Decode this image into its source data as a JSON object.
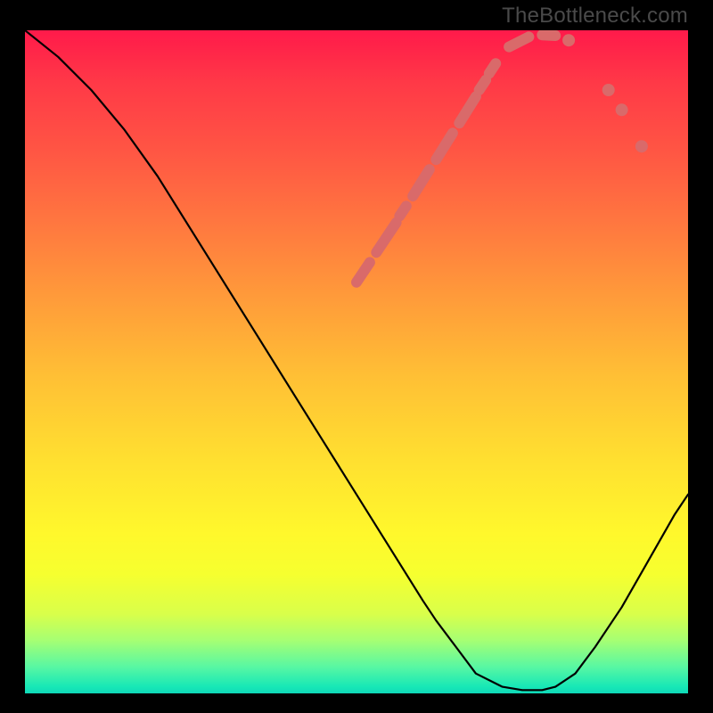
{
  "watermark": "TheBottleneck.com",
  "chart_data": {
    "type": "line",
    "title": "",
    "xlabel": "",
    "ylabel": "",
    "xlim": [
      0,
      100
    ],
    "ylim": [
      0,
      100
    ],
    "grid": false,
    "legend": false,
    "background": {
      "type": "vertical_gradient",
      "stops": [
        {
          "pos": 0,
          "color": "#ff1a4a"
        },
        {
          "pos": 0.18,
          "color": "#ff5544"
        },
        {
          "pos": 0.4,
          "color": "#ff9a3a"
        },
        {
          "pos": 0.65,
          "color": "#ffe030"
        },
        {
          "pos": 0.82,
          "color": "#f6ff2f"
        },
        {
          "pos": 0.92,
          "color": "#a6ff73"
        },
        {
          "pos": 1.0,
          "color": "#0fd8b8"
        }
      ]
    },
    "series": [
      {
        "name": "bottleneck-curve",
        "x": [
          0,
          5,
          10,
          15,
          20,
          25,
          30,
          35,
          40,
          45,
          50,
          55,
          60,
          62,
          65,
          68,
          72,
          75,
          78,
          80,
          83,
          86,
          90,
          94,
          98,
          100
        ],
        "y": [
          100,
          96,
          91,
          85,
          78,
          70,
          62,
          54,
          46,
          38,
          30,
          22,
          14,
          11,
          7,
          3,
          1,
          0.5,
          0.5,
          1,
          3,
          7,
          13,
          20,
          27,
          30
        ]
      }
    ],
    "markers": [
      {
        "name": "segment-a",
        "type": "dash",
        "x1": 50.0,
        "y1": 62.0,
        "x2": 52.0,
        "y2": 65.0
      },
      {
        "name": "segment-b",
        "type": "dash",
        "x1": 53.0,
        "y1": 66.5,
        "x2": 56.0,
        "y2": 71.0
      },
      {
        "name": "segment-c",
        "type": "dash",
        "x1": 56.5,
        "y1": 72.0,
        "x2": 57.5,
        "y2": 73.5
      },
      {
        "name": "segment-d",
        "type": "dash",
        "x1": 58.5,
        "y1": 75.0,
        "x2": 61.0,
        "y2": 79.0
      },
      {
        "name": "segment-e",
        "type": "dash",
        "x1": 62.0,
        "y1": 80.5,
        "x2": 64.5,
        "y2": 84.5
      },
      {
        "name": "segment-f",
        "type": "dash",
        "x1": 65.5,
        "y1": 86.0,
        "x2": 68.0,
        "y2": 90.0
      },
      {
        "name": "segment-g",
        "type": "dash",
        "x1": 68.5,
        "y1": 91.0,
        "x2": 69.5,
        "y2": 92.5
      },
      {
        "name": "segment-h",
        "type": "dash",
        "x1": 70.0,
        "y1": 93.5,
        "x2": 71.0,
        "y2": 95.0
      },
      {
        "name": "segment-i",
        "type": "dash",
        "x1": 73.0,
        "y1": 97.5,
        "x2": 76.0,
        "y2": 99.0
      },
      {
        "name": "segment-j",
        "type": "dash",
        "x1": 78.0,
        "y1": 99.3,
        "x2": 80.0,
        "y2": 99.2
      },
      {
        "name": "dot-k",
        "type": "dot",
        "x": 82.0,
        "y": 98.5
      },
      {
        "name": "dot-l",
        "type": "dot",
        "x": 88.0,
        "y": 91.0
      },
      {
        "name": "dot-m",
        "type": "dot",
        "x": 90.0,
        "y": 88.0
      },
      {
        "name": "dot-n",
        "type": "dot",
        "x": 93.0,
        "y": 82.5
      }
    ]
  }
}
